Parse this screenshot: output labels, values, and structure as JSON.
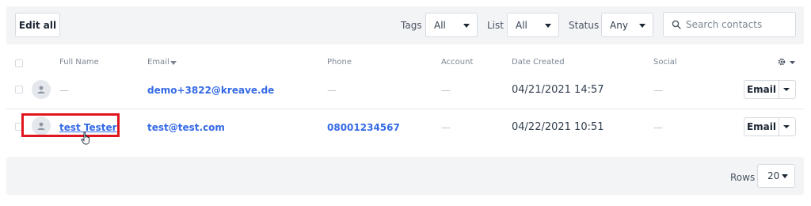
{
  "toolbar": {
    "edit_all_label": "Edit all",
    "filters": [
      {
        "label": "Tags",
        "value": "All"
      },
      {
        "label": "List",
        "value": "All"
      },
      {
        "label": "Status",
        "value": "Any"
      }
    ],
    "search_placeholder": "Search contacts"
  },
  "table": {
    "columns": [
      "Full Name",
      "Email",
      "Phone",
      "Account",
      "Date Created",
      "Social"
    ],
    "rows": [
      {
        "name": "—",
        "email": "demo+3822@kreave.de",
        "phone": "—",
        "account": "—",
        "date_created": "04/21/2021 14:57",
        "social": "—",
        "action": "Email"
      },
      {
        "name": "test Tester",
        "email": "test@test.com",
        "phone": "08001234567",
        "account": "—",
        "date_created": "04/22/2021 10:51",
        "social": "—",
        "action": "Email"
      }
    ]
  },
  "footer": {
    "rows_label": "Rows",
    "rows_value": "20"
  },
  "colors": {
    "link": "#356ae6",
    "highlight": "#e0161e",
    "panel_bg": "#f3f4f6"
  },
  "icons": [
    "search-icon",
    "gear-icon",
    "avatar-icon",
    "chevron-down-icon",
    "hand-cursor-icon",
    "sort-caret-icon"
  ]
}
